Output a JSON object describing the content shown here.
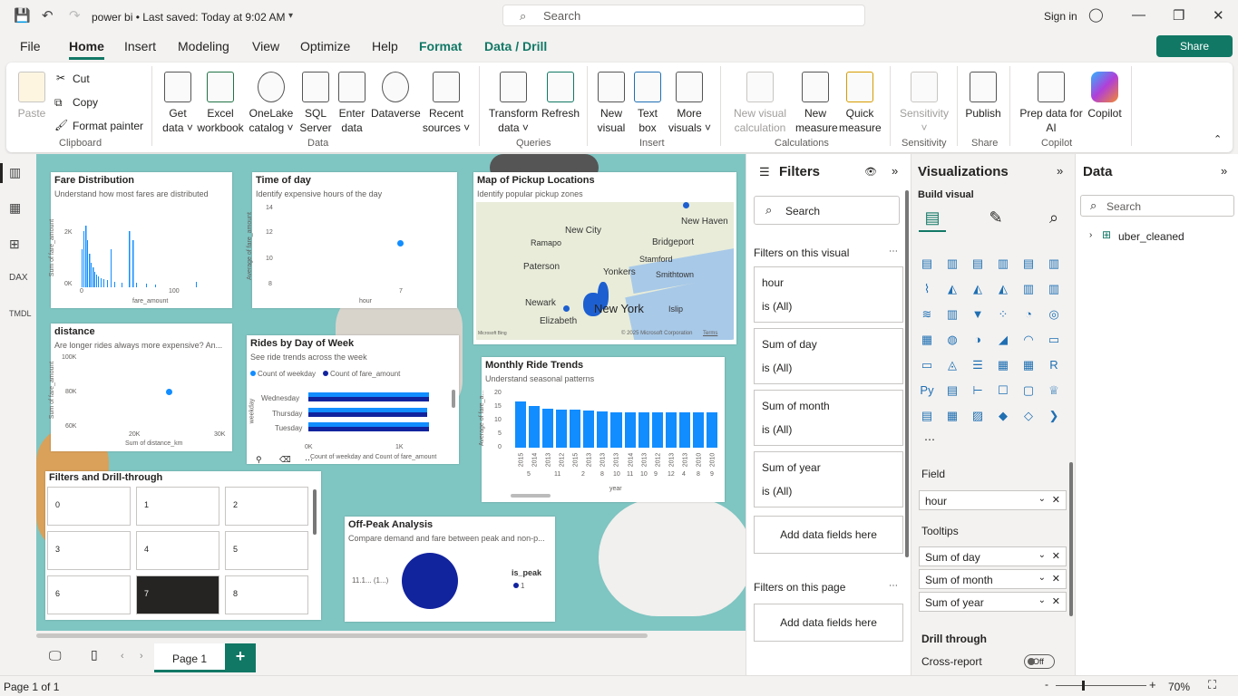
{
  "titlebar": {
    "doc_title": "power bi • Last saved: Today at 9:02 AM",
    "search_placeholder": "Search",
    "signin": "Sign in"
  },
  "menu": [
    "File",
    "Home",
    "Insert",
    "Modeling",
    "View",
    "Optimize",
    "Help",
    "Format",
    "Data / Drill"
  ],
  "share_label": "Share",
  "ribbon": {
    "clipboard": {
      "paste": "Paste",
      "cut": "Cut",
      "copy": "Copy",
      "format_painter": "Format painter",
      "group": "Clipboard"
    },
    "data": {
      "get_data": "Get\ndata ˅",
      "excel": "Excel\nworkbook",
      "onelake": "OneLake\ncatalog ˅",
      "sql": "SQL\nServer",
      "enter": "Enter\ndata",
      "dataverse": "Dataverse",
      "recent": "Recent\nsources ˅",
      "group": "Data"
    },
    "queries": {
      "transform": "Transform\ndata ˅",
      "refresh": "Refresh",
      "group": "Queries"
    },
    "insert": {
      "new_visual": "New\nvisual",
      "text_box": "Text\nbox",
      "more_visuals": "More\nvisuals ˅",
      "group": "Insert"
    },
    "calculations": {
      "new_calc": "New visual\ncalculation",
      "new_measure": "New\nmeasure",
      "quick_measure": "Quick\nmeasure",
      "group": "Calculations"
    },
    "sensitivity": {
      "label": "Sensitivity\n˅",
      "group": "Sensitivity"
    },
    "share": {
      "publish": "Publish",
      "group": "Share"
    },
    "copilot": {
      "prep": "Prep data for\nAI",
      "copilot": "Copilot",
      "group": "Copilot"
    }
  },
  "visuals": {
    "fare": {
      "title": "Fare Distribution",
      "subtitle": "Understand how most fares are distributed",
      "ylabel": "Sum of fare_amount",
      "xlabel": "fare_amount",
      "yticks": [
        "2K",
        "0K"
      ],
      "xticks": [
        "0",
        "100"
      ]
    },
    "time": {
      "title": "Time of day",
      "subtitle": "Identify expensive hours of the day",
      "ylabel": "Average of fare_amount",
      "xlabel": "hour",
      "yticks": [
        "14",
        "12",
        "10",
        "8"
      ],
      "xticks": [
        "7"
      ]
    },
    "map": {
      "title": "Map of Pickup Locations",
      "subtitle": "Identify popular pickup zones",
      "labels": [
        "New City",
        "New Haven",
        "Bridgeport",
        "Ramapo",
        "Stamford",
        "Paterson",
        "Yonkers",
        "Smithtown",
        "Newark",
        "New York",
        "Islip",
        "Elizabeth"
      ],
      "copyright": "© 2025 Microsoft Corporation",
      "terms": "Terms",
      "bing": "Microsoft Bing"
    },
    "distance": {
      "title": "distance",
      "subtitle": "Are longer rides always more expensive? An...",
      "ylabel": "Sum of fare_amount",
      "xlabel": "Sum of distance_km",
      "yticks": [
        "100K",
        "80K",
        "60K"
      ],
      "xticks": [
        "20K",
        "30K"
      ]
    },
    "rides": {
      "title": "Rides by Day of Week",
      "subtitle": "See ride trends across the week",
      "legend": [
        "Count of weekday",
        "Count of fare_amount"
      ],
      "categories": [
        "Wednesday",
        "Thursday",
        "Tuesday"
      ],
      "ylabel": "weekday",
      "xlabel": "Count of weekday and Count of fare_amount",
      "xticks": [
        "0K",
        "1K"
      ]
    },
    "monthly": {
      "title": "Monthly Ride Trends",
      "subtitle": "Understand seasonal patterns",
      "ylabel": "Average of fare_a...",
      "xlabel": "year",
      "yticks": [
        "20",
        "15",
        "10",
        "5",
        "0"
      ],
      "years": [
        "2015",
        "2014",
        "2013",
        "2012",
        "2015",
        "2013",
        "2013",
        "2013",
        "2014",
        "2013",
        "2012",
        "2013",
        "2013",
        "2010",
        "2010"
      ],
      "months": [
        "5",
        "11",
        "2",
        "8",
        "10",
        "11",
        "10",
        "9",
        "12",
        "4",
        "8",
        "9"
      ],
      "values": [
        17,
        15.5,
        14.5,
        14,
        14,
        13.8,
        13.5,
        13,
        13,
        13,
        13,
        13,
        13,
        13,
        13
      ]
    },
    "drill": {
      "title": "Filters and Drill-through",
      "cells": [
        "0",
        "1",
        "2",
        "3",
        "4",
        "5",
        "6",
        "7",
        "8"
      ]
    },
    "offpeak": {
      "title": "Off-Peak Analysis",
      "subtitle": "Compare demand and fare between peak and non-p...",
      "slice_label": "11.1... (1...)",
      "legend_title": "is_peak",
      "legend_item": "1"
    }
  },
  "filters": {
    "title": "Filters",
    "search": "Search",
    "on_visual": "Filters on this visual",
    "cards": [
      {
        "name": "hour",
        "value": "is (All)"
      },
      {
        "name": "Sum of day",
        "value": "is (All)"
      },
      {
        "name": "Sum of month",
        "value": "is (All)"
      },
      {
        "name": "Sum of year",
        "value": "is (All)"
      }
    ],
    "add_here": "Add data fields here",
    "on_page": "Filters on this page",
    "add_page": "Add data fields here"
  },
  "viz": {
    "title": "Visualizations",
    "build": "Build visual",
    "field_label": "Field",
    "field_value": "hour",
    "tooltips_label": "Tooltips",
    "tooltips": [
      "Sum of day",
      "Sum of month",
      "Sum of year"
    ],
    "drill_label": "Drill through",
    "cross_report": "Cross-report",
    "toggle": "Off"
  },
  "data": {
    "title": "Data",
    "search": "Search",
    "table": "uber_cleaned"
  },
  "pages": {
    "tab": "Page 1"
  },
  "status": {
    "page": "Page 1 of 1",
    "zoom": "70%"
  },
  "colors": {
    "accent": "#117865",
    "bar": "#118DFF",
    "navy": "#12239E"
  }
}
